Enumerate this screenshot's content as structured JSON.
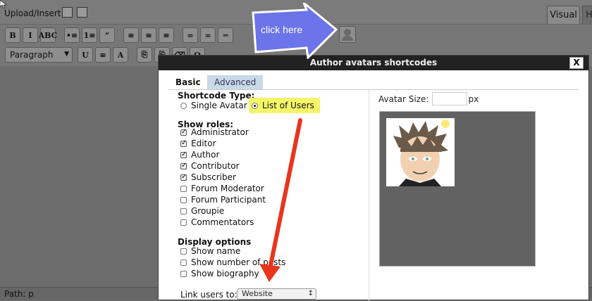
{
  "editor": {
    "upload_label": "Upload/Insert",
    "tabs": [
      {
        "label": "Visual"
      },
      {
        "label": "H"
      }
    ],
    "paragraph_format": "Paragraph",
    "path_label": "Path: p",
    "toolbar_row1": [
      {
        "icon": "bold-icon",
        "glyph": "B"
      },
      {
        "icon": "italic-icon",
        "glyph": "I"
      },
      {
        "icon": "strikethrough-icon",
        "glyph": "ABC"
      },
      {
        "icon": "bullet-list-icon",
        "glyph": "•≡"
      },
      {
        "icon": "numbered-list-icon",
        "glyph": "1≡"
      },
      {
        "icon": "blockquote-icon",
        "glyph": "“"
      },
      {
        "icon": "align-left-icon",
        "glyph": "≡"
      },
      {
        "icon": "align-center-icon",
        "glyph": "≡"
      },
      {
        "icon": "align-right-icon",
        "glyph": "≡"
      },
      {
        "icon": "link-icon",
        "glyph": "∞"
      },
      {
        "icon": "unlink-icon",
        "glyph": "∞"
      },
      {
        "icon": "more-tag-icon",
        "glyph": "═"
      }
    ],
    "toolbar_row2": [
      {
        "icon": "underline-icon",
        "glyph": "U"
      },
      {
        "icon": "justify-icon",
        "glyph": "≡"
      },
      {
        "icon": "text-color-icon",
        "glyph": "A"
      },
      {
        "icon": "paste-text-icon",
        "glyph": "⎘"
      },
      {
        "icon": "paste-word-icon",
        "glyph": "⎘"
      },
      {
        "icon": "remove-format-icon",
        "glyph": "⌫"
      },
      {
        "icon": "special-char-icon",
        "glyph": "Ω"
      }
    ]
  },
  "annotation": {
    "arrow_text": "click here"
  },
  "dialog": {
    "title": "Author avatars shortcodes",
    "close_label": "X",
    "tabs": [
      {
        "label": "Basic"
      },
      {
        "label": "Advanced"
      }
    ],
    "shortcode_type": {
      "heading": "Shortcode Type:",
      "options": [
        {
          "label": "Single Avatar",
          "selected": false
        },
        {
          "label": "List of Users",
          "selected": true
        }
      ]
    },
    "roles": {
      "heading": "Show roles:",
      "items": [
        {
          "label": "Administrator",
          "checked": true
        },
        {
          "label": "Editor",
          "checked": true
        },
        {
          "label": "Author",
          "checked": true
        },
        {
          "label": "Contributor",
          "checked": true
        },
        {
          "label": "Subscriber",
          "checked": true
        },
        {
          "label": "Forum Moderator",
          "checked": false
        },
        {
          "label": "Forum Participant",
          "checked": false
        },
        {
          "label": "Groupie",
          "checked": false
        },
        {
          "label": "Commentators",
          "checked": false
        }
      ]
    },
    "display": {
      "heading": "Display options",
      "items": [
        {
          "label": "Show name",
          "checked": false
        },
        {
          "label": "Show number of posts",
          "checked": false
        },
        {
          "label": "Show biography",
          "checked": false
        }
      ]
    },
    "link_users": {
      "label": "Link users to:",
      "value": "Website"
    },
    "avatar_size": {
      "label": "Avatar Size:",
      "unit": "px",
      "value": ""
    },
    "colors": {
      "title_bar": "#222222",
      "highlight": "#f5f56a",
      "annotation_arrow": "#6b74e8",
      "red_arrow": "#e8351c"
    }
  }
}
